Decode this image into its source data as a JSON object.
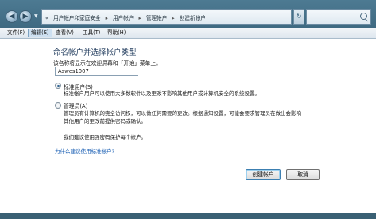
{
  "address": {
    "crumbs": [
      "用户帐户和家庭安全",
      "用户帐户",
      "管理帐户",
      "创建新帐户"
    ],
    "separator": "▸",
    "root_glyph": "«"
  },
  "menu": {
    "items": [
      "文件(F)",
      "编辑(E)",
      "查看(V)",
      "工具(T)",
      "帮助(H)"
    ],
    "active_index": 1
  },
  "page": {
    "heading": "命名帐户并选择帐户类型",
    "name_prompt": "该名称将显示在欢迎屏幕和「开始」菜单上。",
    "name_value": "Aswes1007",
    "options": [
      {
        "label": "标准用户(S)",
        "description": "标准帐户用户可以使用大多数软件以及更改不影响其他用户或计算机安全的系统设置。",
        "checked": true
      },
      {
        "label": "管理员(A)",
        "description_lines": [
          "管理员有计算机的完全访问权，可以做任何需要的更改。根据通知设置，可能会要求管理员在做出会影响",
          "其他用户的更改前提供密码或确认。"
        ],
        "checked": false
      }
    ],
    "recommendation": "我们建议使用强密码保护每个帐户。",
    "help_link": "为什么建议使用标准帐户?",
    "create_button": "创建帐户",
    "cancel_button": "取消"
  },
  "colors": {
    "heading": "#1e395b",
    "link": "#1a5fb4",
    "frame": "#3f6a82"
  }
}
